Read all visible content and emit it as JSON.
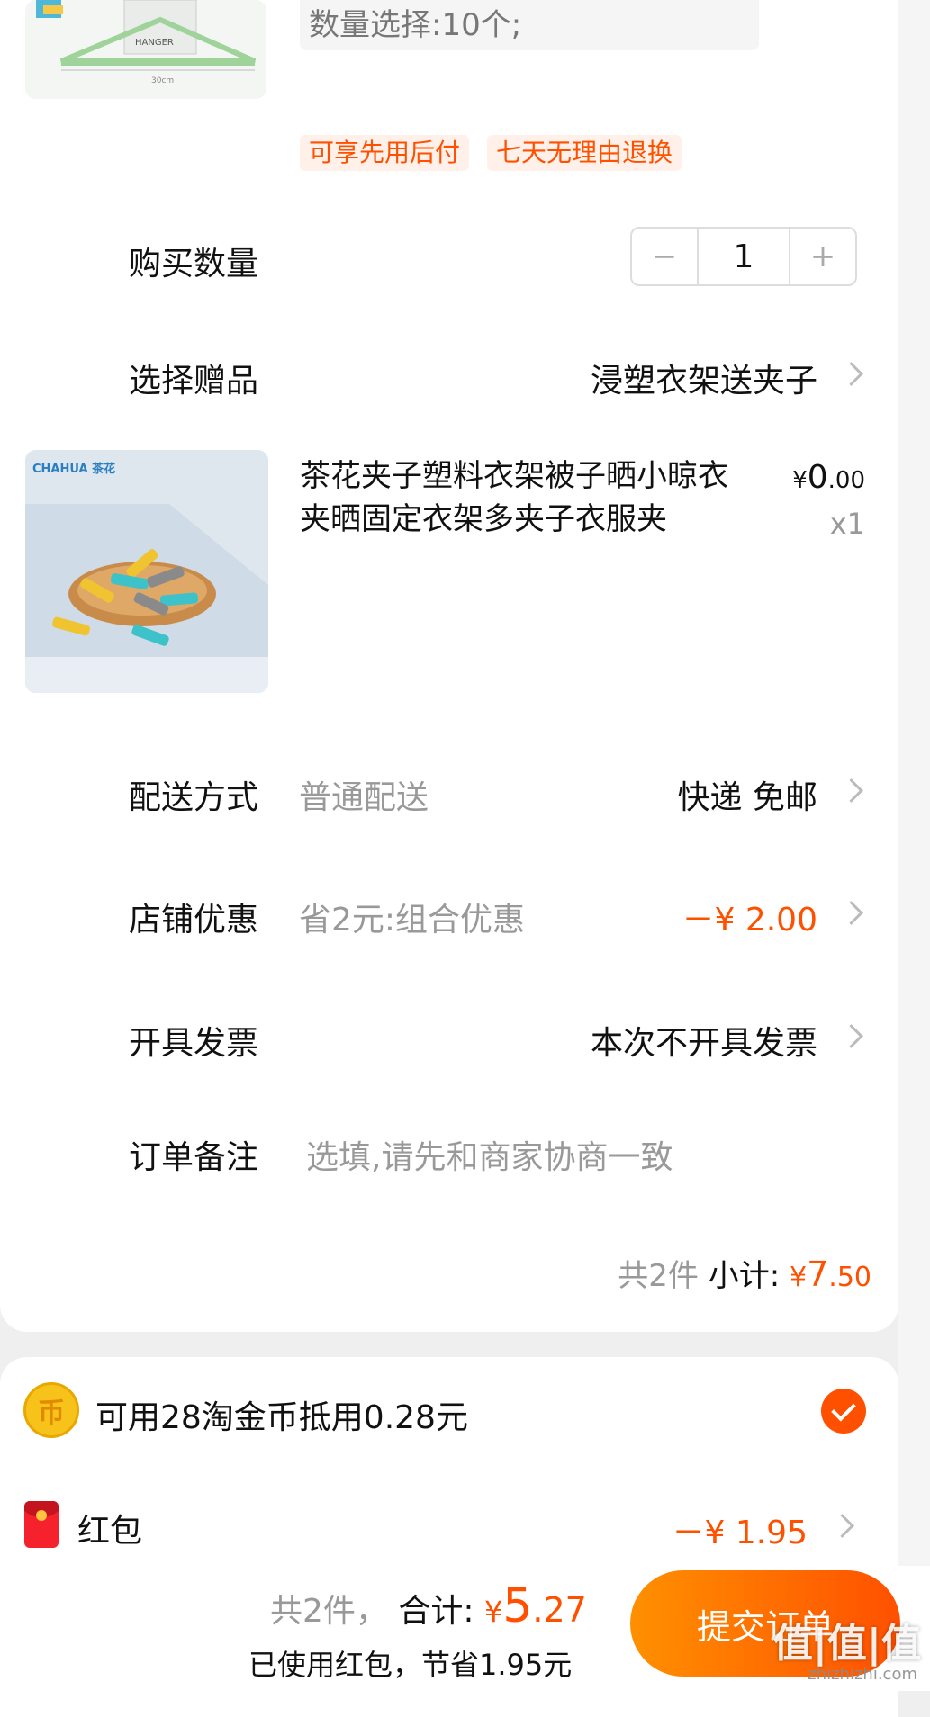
{
  "product": {
    "spec_text": "数量选择:10个;",
    "tags": [
      "可享先用后付",
      "七天无理由退换"
    ]
  },
  "quantity": {
    "label": "购买数量",
    "value": "1",
    "minus": "−",
    "plus": "+"
  },
  "gift_select": {
    "label": "选择赠品",
    "value": "浸塑衣架送夹子"
  },
  "gift_item": {
    "brand": "CHAHUA 茶花",
    "title": "茶花夹子塑料衣架被子晒小晾衣夹晒固定衣架多夹子衣服夹",
    "price_symbol": "¥",
    "price_int": "0",
    "price_dec": ".00",
    "qty": "x1"
  },
  "delivery": {
    "label": "配送方式",
    "sub": "普通配送",
    "value": "快递 免邮"
  },
  "shop_discount": {
    "label": "店铺优惠",
    "sub": "省2元:组合优惠",
    "value": "－¥ 2.00"
  },
  "invoice": {
    "label": "开具发票",
    "value": "本次不开具发票"
  },
  "remark": {
    "label": "订单备注",
    "placeholder": "选填,请先和商家协商一致"
  },
  "subtotal": {
    "count": "共2件",
    "label": "小计:",
    "symbol": "¥",
    "int": "7",
    "dec": ".50"
  },
  "coins": {
    "icon": "coin-icon",
    "text": "可用28淘金币抵用0.28元",
    "checked": true
  },
  "red_packet": {
    "icon": "red-packet-icon",
    "label": "红包",
    "value": "－¥ 1.95"
  },
  "footer": {
    "count": "共2件，",
    "total_label": "合计:",
    "symbol": "¥",
    "total_int": "5",
    "total_dec": ".27",
    "saved": "已使用红包，节省1.95元",
    "submit": "提交订单"
  },
  "watermark": {
    "text": "值|值|值",
    "sub": "zhizhizhi.com"
  },
  "colors": {
    "accent": "#ff5000",
    "button_start": "#ff9000",
    "tag_bg": "#fff0ea"
  }
}
